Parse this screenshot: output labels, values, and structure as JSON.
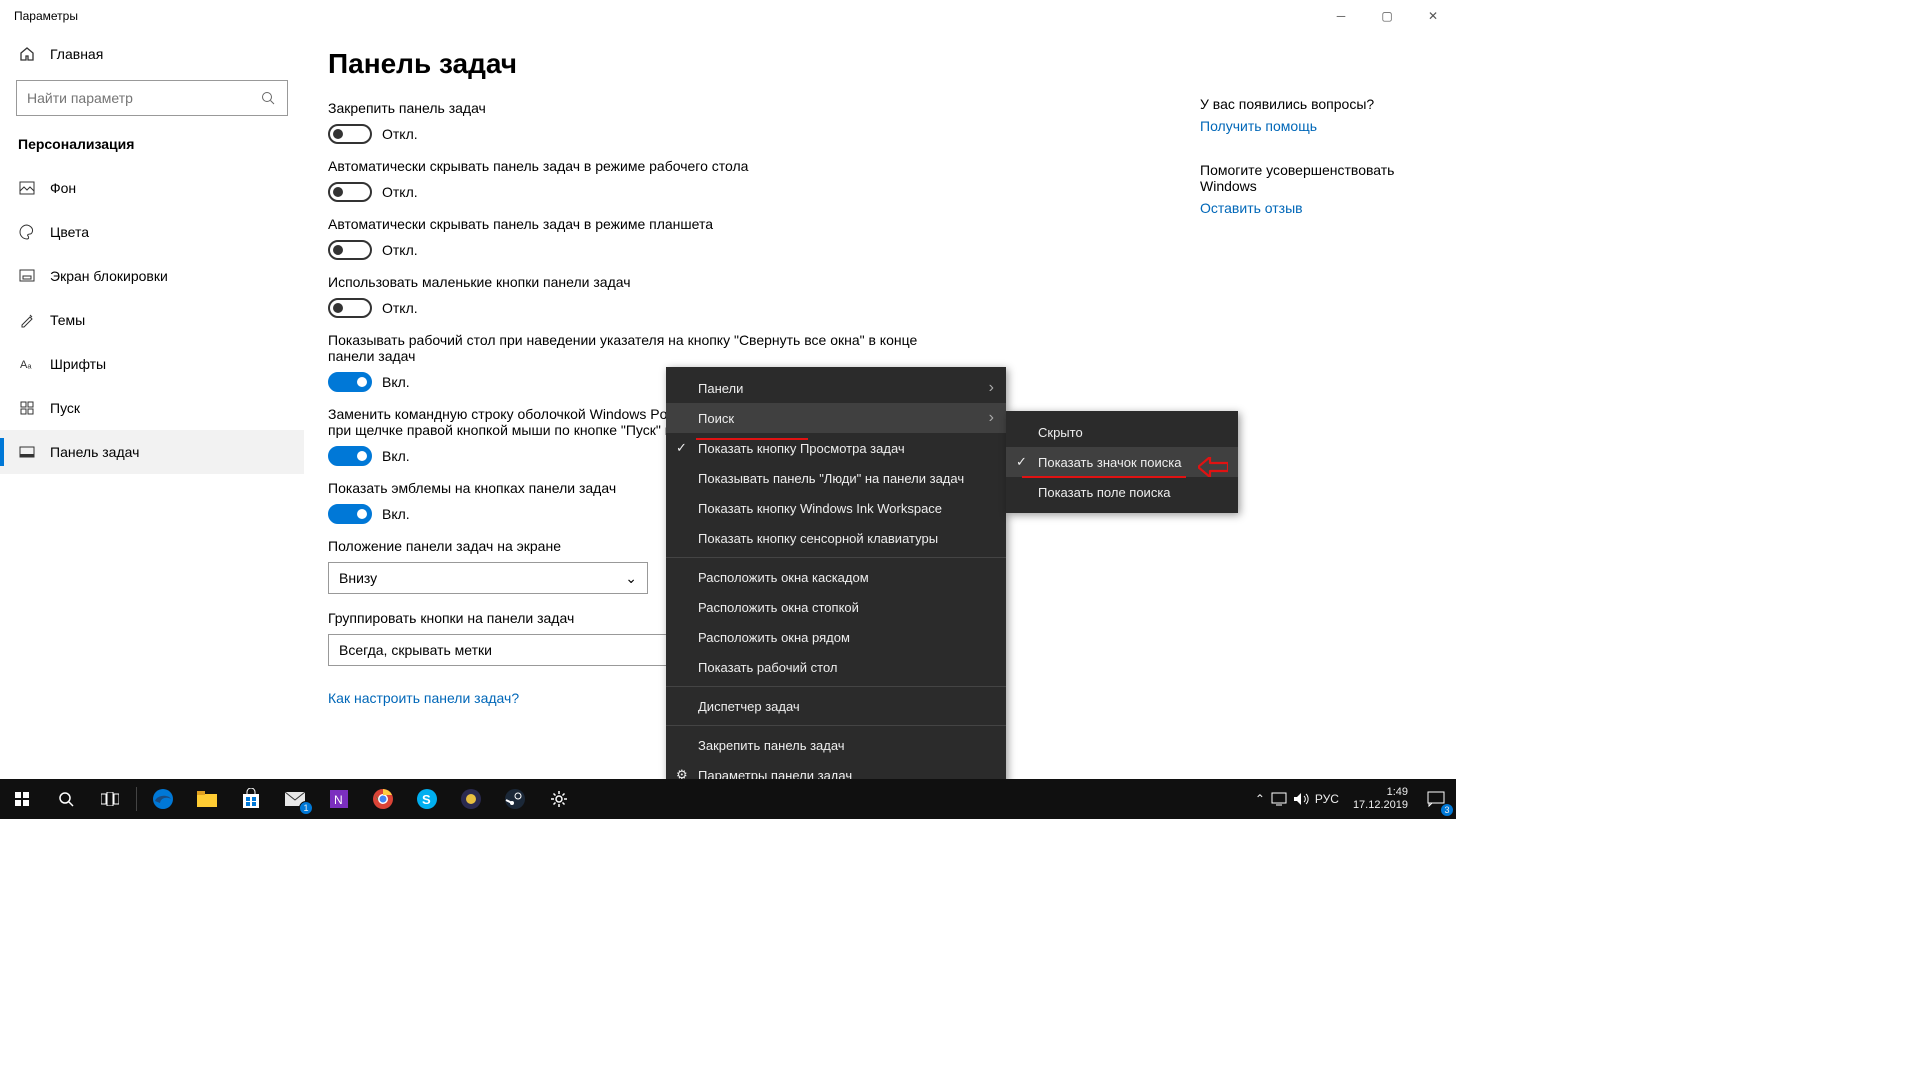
{
  "titlebar": {
    "title": "Параметры"
  },
  "sidebar": {
    "home": "Главная",
    "search_placeholder": "Найти параметр",
    "category": "Персонализация",
    "items": [
      {
        "label": "Фон"
      },
      {
        "label": "Цвета"
      },
      {
        "label": "Экран блокировки"
      },
      {
        "label": "Темы"
      },
      {
        "label": "Шрифты"
      },
      {
        "label": "Пуск"
      },
      {
        "label": "Панель задач"
      }
    ]
  },
  "page": {
    "title": "Панель задач",
    "toggles": [
      {
        "label": "Закрепить панель задач",
        "state": "Откл.",
        "on": false
      },
      {
        "label": "Автоматически скрывать панель задач в режиме рабочего стола",
        "state": "Откл.",
        "on": false
      },
      {
        "label": "Автоматически скрывать панель задач в режиме планшета",
        "state": "Откл.",
        "on": false
      },
      {
        "label": "Использовать маленькие кнопки панели задач",
        "state": "Откл.",
        "on": false
      },
      {
        "label": "Показывать рабочий стол при наведении указателя на кнопку \"Свернуть все окна\" в конце панели задач",
        "state": "Вкл.",
        "on": true
      },
      {
        "label": "Заменить командную строку оболочкой Windows PowerShell в меню, которое появляется при щелчке правой кнопкой мыши по кнопке \"Пуск\" или при нажатии клавиш Windows+X",
        "state": "Вкл.",
        "on": true
      },
      {
        "label": "Показать эмблемы на кнопках панели задач",
        "state": "Вкл.",
        "on": true
      }
    ],
    "combo1": {
      "label": "Положение панели задач на экране",
      "value": "Внизу"
    },
    "combo2": {
      "label": "Группировать кнопки на панели задач",
      "value": "Всегда, скрывать метки"
    },
    "help_link": "Как настроить панели задач?"
  },
  "aside": {
    "q": "У вас появились вопросы?",
    "help": "Получить помощь",
    "improve": "Помогите усовершенствовать Windows",
    "feedback": "Оставить отзыв"
  },
  "context_menu": {
    "items": [
      {
        "label": "Панели",
        "sub": true
      },
      {
        "label": "Поиск",
        "sub": true,
        "hover": true,
        "underline": true
      },
      {
        "label": "Показать кнопку Просмотра задач",
        "chk": true
      },
      {
        "label": "Показывать панель \"Люди\" на панели задач"
      },
      {
        "label": "Показать кнопку Windows Ink Workspace"
      },
      {
        "label": "Показать кнопку сенсорной клавиатуры"
      },
      {
        "sep": true
      },
      {
        "label": "Расположить окна каскадом"
      },
      {
        "label": "Расположить окна стопкой"
      },
      {
        "label": "Расположить окна рядом"
      },
      {
        "label": "Показать рабочий стол"
      },
      {
        "sep": true
      },
      {
        "label": "Диспетчер задач"
      },
      {
        "sep": true
      },
      {
        "label": "Закрепить панель задач"
      },
      {
        "label": "Параметры панели задач",
        "gear": true
      }
    ],
    "submenu": [
      {
        "label": "Скрыто"
      },
      {
        "label": "Показать значок поиска",
        "chk": true,
        "hover": true,
        "underline": true
      },
      {
        "label": "Показать поле поиска"
      }
    ]
  },
  "taskbar": {
    "tray": {
      "lang": "РУС",
      "time": "1:49",
      "date": "17.12.2019",
      "notif": "3"
    }
  }
}
